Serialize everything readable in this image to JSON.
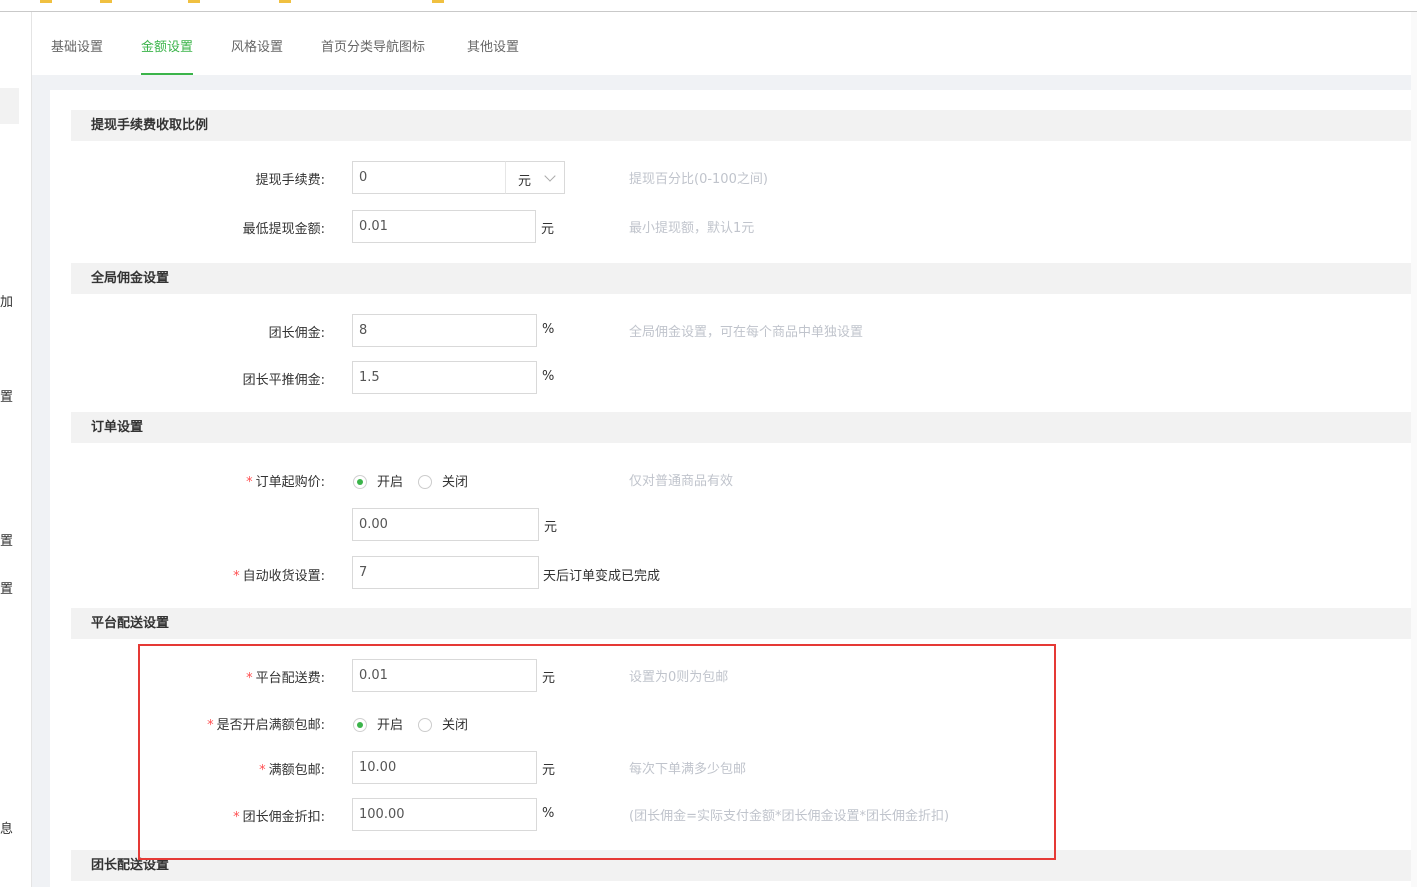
{
  "left_fragments": [
    "加",
    "置",
    "置",
    "置",
    "息"
  ],
  "tabs": [
    {
      "label": "基础设置",
      "active": false
    },
    {
      "label": "金额设置",
      "active": true
    },
    {
      "label": "风格设置",
      "active": false
    },
    {
      "label": "首页分类导航图标",
      "active": false
    },
    {
      "label": "其他设置",
      "active": false
    }
  ],
  "sections": {
    "withdraw": "提现手续费收取比例",
    "commission": "全局佣金设置",
    "order": "订单设置",
    "delivery": "平台配送设置",
    "leader_delivery": "团长配送设置"
  },
  "withdraw": {
    "fee_label": "提现手续费:",
    "fee_value": "0",
    "fee_unit_select": "元",
    "fee_hint": "提现百分比(0-100之间)",
    "min_label": "最低提现金额:",
    "min_value": "0.01",
    "min_unit": "元",
    "min_hint": "最小提现额，默认1元"
  },
  "commission": {
    "leader_label": "团长佣金:",
    "leader_value": "8",
    "leader_unit": "%",
    "leader_hint": "全局佣金设置，可在每个商品中单独设置",
    "push_label": "团长平推佣金:",
    "push_value": "1.5",
    "push_unit": "%"
  },
  "order": {
    "min_price_label": "订单起购价:",
    "radio_on": "开启",
    "radio_off": "关闭",
    "min_price_hint": "仅对普通商品有效",
    "min_price_value": "0.00",
    "min_price_unit": "元",
    "auto_receive_label": "自动收货设置:",
    "auto_receive_value": "7",
    "auto_receive_unit": "天后订单变成已完成"
  },
  "delivery": {
    "fee_label": "平台配送费:",
    "fee_value": "0.01",
    "fee_unit": "元",
    "fee_hint": "设置为0则为包邮",
    "free_label": "是否开启满额包邮:",
    "radio_on": "开启",
    "radio_off": "关闭",
    "threshold_label": "满额包邮:",
    "threshold_value": "10.00",
    "threshold_unit": "元",
    "threshold_hint": "每次下单满多少包邮",
    "discount_label": "团长佣金折扣:",
    "discount_value": "100.00",
    "discount_unit": "%",
    "discount_hint": "(团长佣金=实际支付金额*团长佣金设置*团长佣金折扣)"
  },
  "colors": {
    "accent": "#3bb44a",
    "required": "#ff4d4f",
    "highlight": "#e53935"
  }
}
